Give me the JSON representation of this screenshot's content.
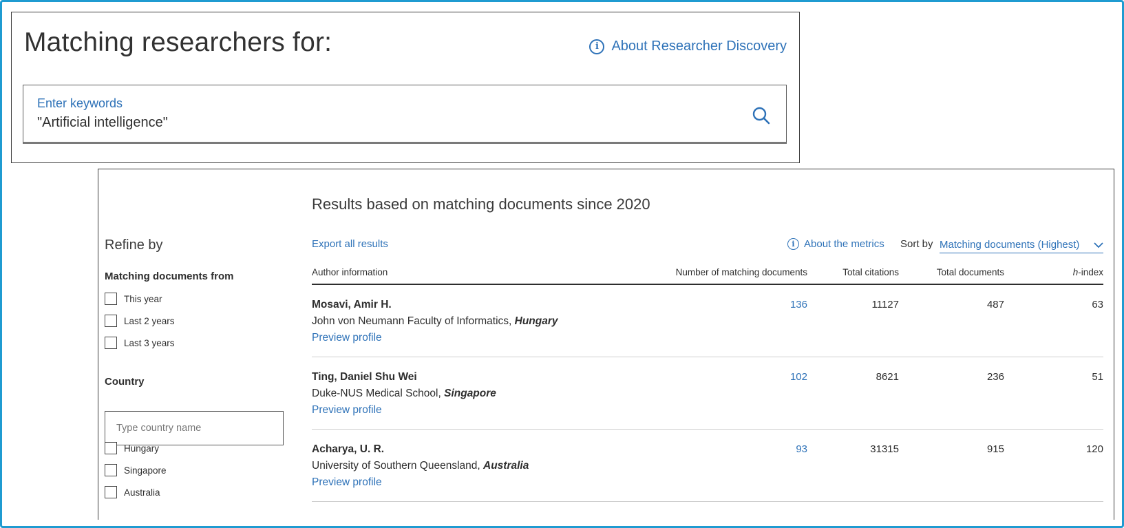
{
  "search_panel": {
    "title": "Matching researchers for:",
    "about_link": "About Researcher Discovery",
    "search_label": "Enter keywords",
    "search_value": "\"Artificial intelligence\""
  },
  "sidebar": {
    "refine_title": "Refine by",
    "matching_heading": "Matching documents from",
    "matching_options": [
      "This year",
      "Last 2 years",
      "Last 3 years"
    ],
    "country_heading": "Country",
    "country_placeholder": "Type country name",
    "country_options": [
      "Hungary",
      "Singapore",
      "Australia"
    ]
  },
  "results": {
    "heading": "Results based on matching documents since 2020",
    "export_label": "Export all results",
    "metrics_label": "About the metrics",
    "sort_label": "Sort by",
    "sort_value": "Matching documents (Highest)",
    "columns": {
      "author": "Author information",
      "matching": "Number of matching documents",
      "citations": "Total citations",
      "documents": "Total documents",
      "h_prefix": "h",
      "h_suffix": "-index"
    },
    "preview_label": "Preview profile",
    "rows": [
      {
        "name": "Mosavi, Amir H.",
        "institution": "John von Neumann Faculty of Informatics, ",
        "country": "Hungary",
        "matching": "136",
        "citations": "11127",
        "documents": "487",
        "h_index": "63"
      },
      {
        "name": "Ting, Daniel Shu Wei",
        "institution": "Duke-NUS Medical School, ",
        "country": "Singapore",
        "matching": "102",
        "citations": "8621",
        "documents": "236",
        "h_index": "51"
      },
      {
        "name": "Acharya, U. R.",
        "institution": "University of Southern Queensland, ",
        "country": "Australia",
        "matching": "93",
        "citations": "31315",
        "documents": "915",
        "h_index": "120"
      }
    ]
  },
  "colors": {
    "link": "#2e72b8",
    "frame": "#1f9bd1",
    "text": "#2e2e2e"
  }
}
